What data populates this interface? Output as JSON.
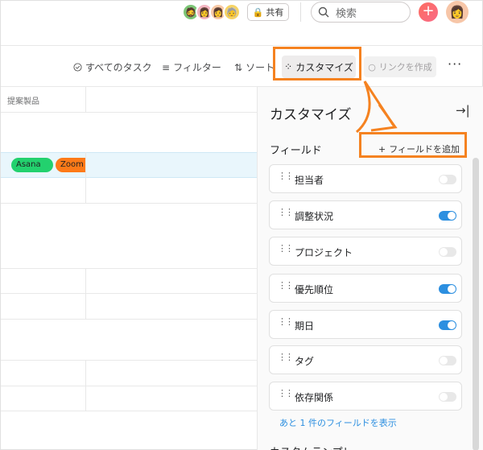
{
  "topbar": {
    "avatars": [
      "🧔",
      "👩",
      "👩",
      "🧓"
    ],
    "share_label": "共有",
    "search_placeholder": "検索",
    "plus_label": "+",
    "me_avatar": "👩"
  },
  "toolbar": {
    "all_tasks": "すべてのタスク",
    "filter": "フィルター",
    "sort": "ソート",
    "customize": "カスタマイズ",
    "create_link": "リンクを作成",
    "more": "···"
  },
  "grid": {
    "column_header": "提案製品",
    "tags": [
      "Asana",
      "Zoom"
    ]
  },
  "panel": {
    "title": "カスタマイズ",
    "fields_label": "フィールド",
    "add_field": "フィールドを追加",
    "fields": [
      {
        "label": "担当者",
        "on": false
      },
      {
        "label": "調整状況",
        "on": true
      },
      {
        "label": "プロジェクト",
        "on": false
      },
      {
        "label": "優先順位",
        "on": true
      },
      {
        "label": "期日",
        "on": true
      },
      {
        "label": "タグ",
        "on": false
      },
      {
        "label": "依存関係",
        "on": false
      }
    ],
    "more_fields": "あと 1 件のフィールドを表示",
    "next_section": "カスタムテンプレ"
  },
  "colors": {
    "highlight": "#f58220",
    "toggle_on": "#2c8fe0",
    "tag_asana": "#23d16e",
    "tag_zoom": "#fd7a18"
  }
}
